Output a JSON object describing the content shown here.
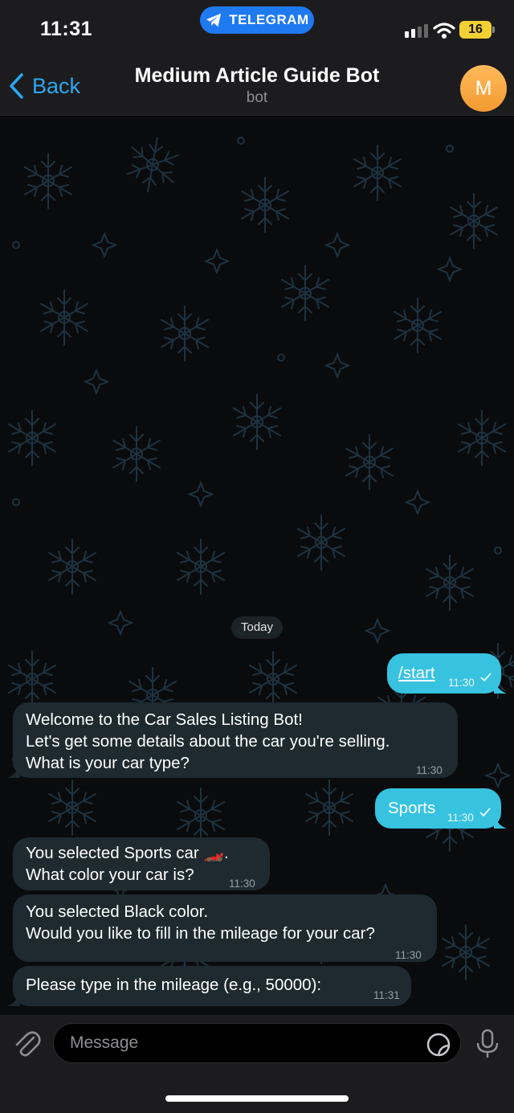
{
  "status_bar": {
    "time": "11:31",
    "app_pill": "TELEGRAM",
    "battery": "16"
  },
  "header": {
    "back_label": "Back",
    "title": "Medium Article Guide Bot",
    "subtitle": "bot",
    "avatar_initial": "M"
  },
  "chat": {
    "date_divider": "Today",
    "messages": [
      {
        "direction": "out",
        "text": "/start",
        "time": "11:30"
      },
      {
        "direction": "in",
        "lines": [
          "Welcome to the Car Sales Listing Bot!",
          "Let's get some details about the car you're selling.",
          "What is your car type?"
        ],
        "time": "11:30"
      },
      {
        "direction": "out",
        "text": "Sports",
        "time": "11:30"
      },
      {
        "direction": "in",
        "lines": [
          "You selected Sports car 🏎️.",
          "What color your car is?"
        ],
        "time": "11:30"
      },
      {
        "direction": "in",
        "lines": [
          "You selected Black color.",
          "Would you like to fill in the mileage for your car?"
        ],
        "time": "11:30"
      },
      {
        "direction": "in",
        "lines": [
          "Please type in the mileage (e.g., 50000):"
        ],
        "time": "11:31"
      }
    ]
  },
  "input": {
    "placeholder": "Message"
  },
  "colors": {
    "accent": "#2aa8f2",
    "outgoing_bubble": "#37c2e0",
    "incoming_bubble": "#1e2a30",
    "wallpaper_pattern": "#1d3340"
  }
}
